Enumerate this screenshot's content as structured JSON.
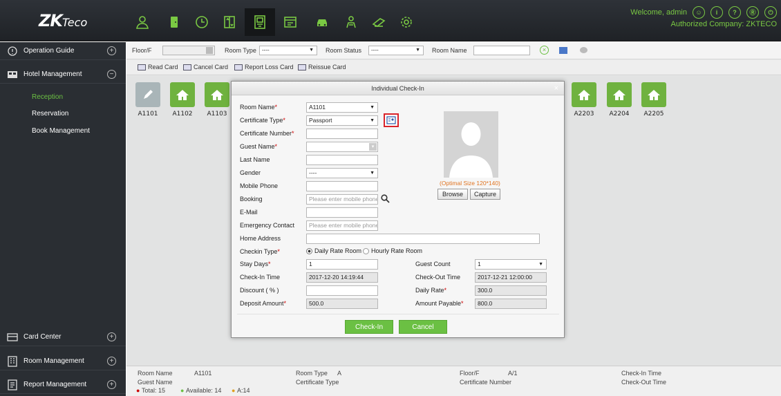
{
  "header": {
    "logo_main": "ZK",
    "logo_small": "Teco",
    "welcome": "Welcome, admin",
    "company": "Authorized Company: ZKTECO",
    "nav_icons": [
      "personnel-icon",
      "door-icon",
      "attendance-icon",
      "elevator-icon",
      "hotel-icon",
      "meeting-icon",
      "parking-icon",
      "patrol-icon",
      "visitor-icon",
      "system-icon"
    ],
    "header_icons": [
      {
        "name": "user-icon",
        "glyph": "☺"
      },
      {
        "name": "info-icon",
        "glyph": "i"
      },
      {
        "name": "help-icon",
        "glyph": "?"
      },
      {
        "name": "account-icon",
        "glyph": "Ⓡ"
      },
      {
        "name": "power-icon",
        "glyph": "⏻"
      }
    ]
  },
  "sidebar": {
    "operation_guide": "Operation Guide",
    "hotel_management": "Hotel Management",
    "items": [
      "Reception",
      "Reservation",
      "Book Management"
    ],
    "active_item": "Reception",
    "card_center": "Card Center",
    "room_management": "Room Management",
    "report_management": "Report Management"
  },
  "filter": {
    "floor_label": "Floor/F",
    "room_type_label": "Room Type",
    "room_type_value": "----",
    "room_status_label": "Room Status",
    "room_status_value": "----",
    "room_name_label": "Room Name"
  },
  "actions": {
    "read_card": "Read Card",
    "cancel_card": "Cancel Card",
    "report_loss": "Report Loss Card",
    "reissue_card": "Reissue Card"
  },
  "rooms": [
    "A1101",
    "A1102",
    "A1103",
    "A2203",
    "A2204",
    "A2205"
  ],
  "info": {
    "room_name_label": "Room Name",
    "room_name_value": "A1101",
    "room_type_label": "Room Type",
    "room_type_value": "A",
    "floor_label": "Floor/F",
    "floor_value": "A/1",
    "checkin_label": "Check-In Time",
    "guest_name_label": "Guest Name",
    "cert_type_label": "Certificate Type",
    "cert_num_label": "Certificate Number",
    "checkout_label": "Check-Out Time",
    "total": "Total: 15",
    "available": "Available: 14",
    "a_count": "A:14"
  },
  "modal": {
    "title": "Individual Check-In",
    "close": "×",
    "room_name_label": "Room Name",
    "room_name_value": "A1101",
    "cert_type_label": "Certificate Type",
    "cert_type_value": "Passport",
    "cert_number_label": "Certificate Number",
    "guest_name_label": "Guest Name",
    "last_name_label": "Last Name",
    "gender_label": "Gender",
    "gender_value": "----",
    "mobile_label": "Mobile Phone",
    "booking_label": "Booking",
    "booking_placeholder": "Please enter mobile phone",
    "email_label": "E-Mail",
    "emergency_label": "Emergency Contact",
    "emergency_placeholder": "Please enter mobile phone",
    "home_label": "Home Address",
    "checkin_type_label": "Checkin Type",
    "daily_rate": "Daily Rate Room",
    "hourly_rate": "Hourly Rate Room",
    "stay_days_label": "Stay Days",
    "stay_days_value": "1",
    "guest_count_label": "Guest Count",
    "guest_count_value": "1",
    "checkin_time_label": "Check-In Time",
    "checkin_time_value": "2017-12-20 14:19:44",
    "checkout_time_label": "Check-Out Time",
    "checkout_time_value": "2017-12-21 12:00:00",
    "discount_label": "Discount ( % )",
    "daily_rate_label": "Daily Rate",
    "daily_rate_value": "300.0",
    "deposit_label": "Deposit Amount",
    "deposit_value": "500.0",
    "amount_payable_label": "Amount Payable",
    "amount_payable_value": "800.0",
    "photo_hint": "(Optimal Size 120*140)",
    "browse": "Browse",
    "capture": "Capture",
    "checkin_btn": "Check-In",
    "cancel_btn": "Cancel",
    "required_mark": "*"
  }
}
